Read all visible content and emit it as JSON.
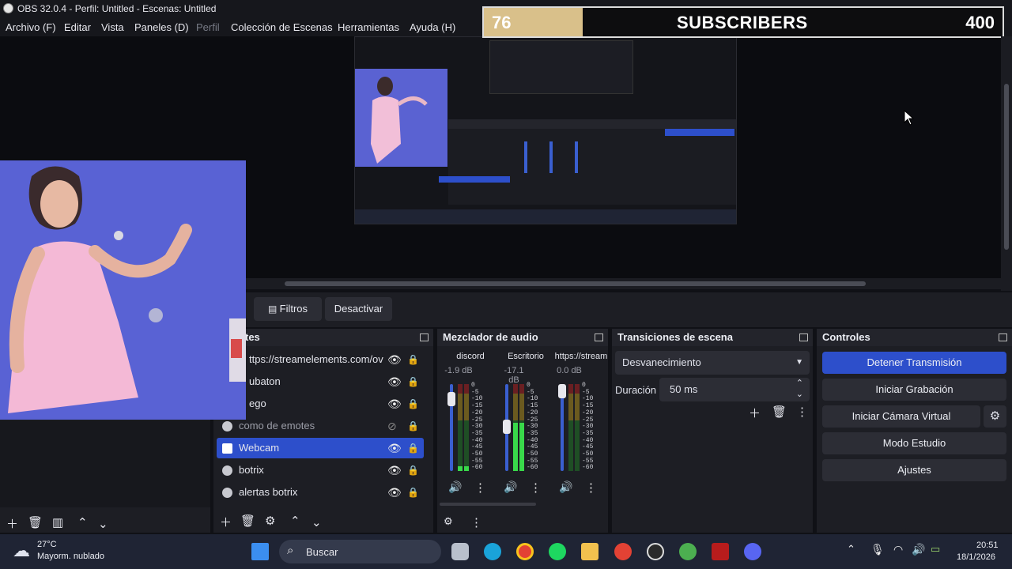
{
  "window": {
    "title": "OBS 32.0.4 - Perfil: Untitled - Escenas: Untitled"
  },
  "menu": [
    "Archivo (F)",
    "Editar",
    "Vista",
    "Paneles (D)",
    "Perfil",
    "Colección de Escenas",
    "Herramientas",
    "Ayuda (H)"
  ],
  "subscriber_bar": {
    "current": "76",
    "label": "SUBSCRIBERS",
    "goal": "400",
    "progress_fraction": 0.19,
    "fill_color": "#d9c08a"
  },
  "toolbar": {
    "filters_label": "Filtros",
    "deactivate_label": "Desactivar"
  },
  "sources": {
    "title_fragment": "tes",
    "items": [
      {
        "label": "ttps://streamelements.com/ov",
        "icon": "browser-icon",
        "visible": true
      },
      {
        "label": "ubaton",
        "icon": "browser-icon",
        "visible": true
      },
      {
        "label": "ego",
        "icon": "browser-icon",
        "visible": true
      },
      {
        "label": "como de emotes",
        "icon": "browser-icon",
        "visible": false
      },
      {
        "label": "Webcam",
        "icon": "camera-icon",
        "visible": true,
        "selected": true
      },
      {
        "label": "botrix",
        "icon": "browser-icon",
        "visible": true
      },
      {
        "label": "alertas botrix",
        "icon": "browser-icon",
        "visible": true
      }
    ]
  },
  "mixer": {
    "title": "Mezclador de audio",
    "scale": [
      "0",
      "-5",
      "-10",
      "-15",
      "-20",
      "-25",
      "-30",
      "-35",
      "-40",
      "-45",
      "-50",
      "-55",
      "-60"
    ],
    "channels": [
      {
        "name": "discord",
        "db": "-1.9 dB",
        "level": 0.05,
        "fader": 0.9
      },
      {
        "name": "Escritorio",
        "db": "-17.1 dB",
        "level": 0.55,
        "fader": 0.55
      },
      {
        "name": "https://stream",
        "db": "0.0 dB",
        "level": 0.0,
        "fader": 1.0
      }
    ]
  },
  "transitions": {
    "title": "Transiciones de escena",
    "selected": "Desvanecimiento",
    "duration_label": "Duración",
    "duration_value": "50 ms"
  },
  "controls": {
    "title": "Controles",
    "stop_stream": "Detener Transmisión",
    "start_recording": "Iniciar Grabación",
    "start_virtual_cam": "Iniciar Cámara Virtual",
    "studio_mode": "Modo Estudio",
    "settings": "Ajustes",
    "accent_color": "#2d4fcb"
  },
  "taskbar": {
    "temperature": "27°C",
    "weather": "Mayorm. nublado",
    "search_placeholder": "Buscar",
    "time": "20:51",
    "date": "18/1/2026"
  }
}
